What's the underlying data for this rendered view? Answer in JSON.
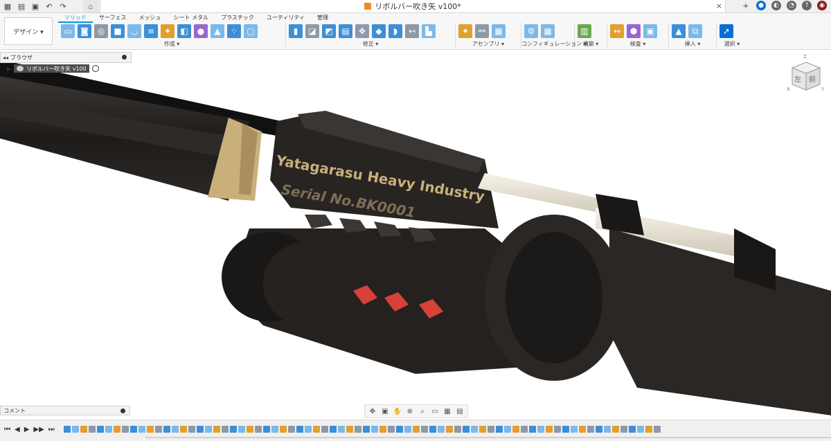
{
  "window": {
    "document_title": "リボルバー吹き矢 v100*",
    "close_glyph": "×"
  },
  "workspace": {
    "label": "デザイン ▾"
  },
  "tabs": [
    {
      "label": "ソリッド",
      "active": true
    },
    {
      "label": "サーフェス",
      "active": false
    },
    {
      "label": "メッシュ",
      "active": false
    },
    {
      "label": "シート メタル",
      "active": false
    },
    {
      "label": "プラスチック",
      "active": false
    },
    {
      "label": "ユーティリティ",
      "active": false
    },
    {
      "label": "管理",
      "active": false
    }
  ],
  "groups": {
    "create": "作成 ▾",
    "modify": "修正 ▾",
    "assemble": "アセンブリ ▾",
    "configure": "コンフィギュレーション ▾",
    "construct": "構築 ▾",
    "inspect": "検査 ▾",
    "insert": "挿入 ▾",
    "select": "選択 ▾"
  },
  "browser": {
    "title": "ブラウザ",
    "root_item": "リボルバー吹き矢 v100"
  },
  "comments": {
    "title": "コメント"
  },
  "viewcube": {
    "left_face": "左",
    "front_face": "前",
    "z_axis": "Z",
    "x_axis": "X",
    "y_axis": "Y"
  },
  "model": {
    "engraving_line1": "Yatagarasu Heavy Industry",
    "engraving_line2": "Serial No.BK0001"
  },
  "colors": {
    "accent": "#0696d7",
    "body": "#2b2826",
    "brass": "#c9b07a",
    "red_accent": "#d8403a"
  },
  "timeline_feature_count": 72
}
